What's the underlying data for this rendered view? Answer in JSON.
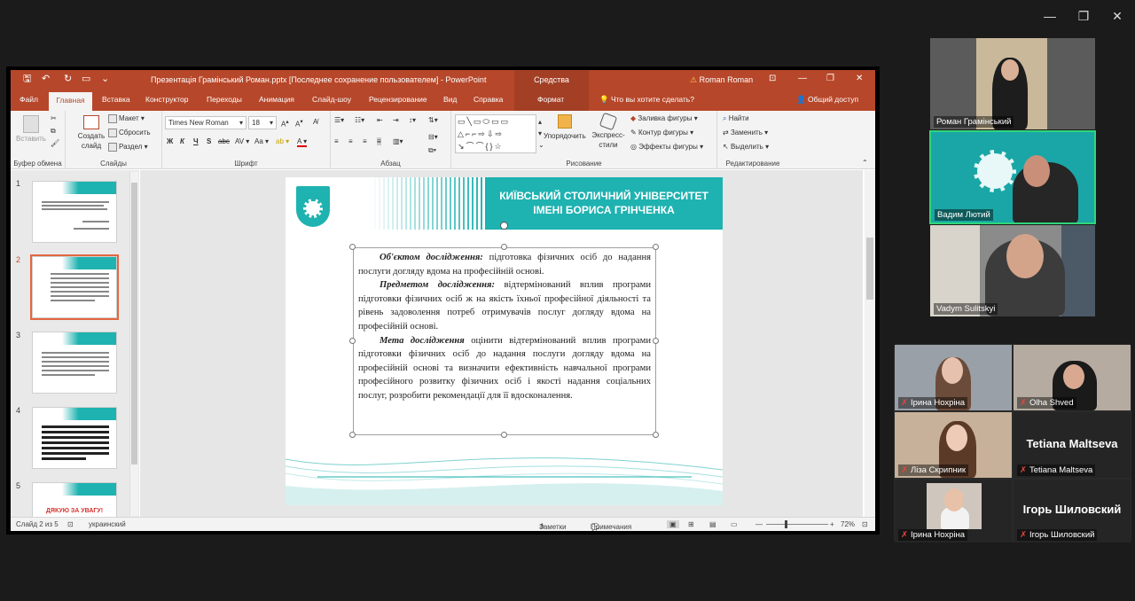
{
  "window_controls": {
    "minimize": "—",
    "maximize": "❐",
    "close": "✕"
  },
  "ppt": {
    "title": "Презентація Грамінський Роман.pptx [Последнее сохранение пользователем] - PowerPoint",
    "context_tab_title": "Средства рисования",
    "user": "Roman Roman",
    "tabs": [
      "Файл",
      "Главная",
      "Вставка",
      "Конструктор",
      "Переходы",
      "Анимация",
      "Слайд-шоу",
      "Рецензирование",
      "Вид",
      "Справка"
    ],
    "context_tab": "Формат",
    "tell_me": "Что вы хотите сделать?",
    "share": "Общий доступ",
    "ribbon": {
      "clipboard": {
        "paste": "Вставить",
        "label": "Буфер обмена"
      },
      "slides": {
        "new_slide": "Создать слайд",
        "layout": "Макет",
        "reset": "Сбросить",
        "section": "Раздел",
        "label": "Слайды"
      },
      "font": {
        "name": "Times New Roman",
        "size": "18",
        "label": "Шрифт"
      },
      "paragraph": {
        "label": "Абзац"
      },
      "drawing": {
        "arrange": "Упорядочить",
        "styles": "Экспресс-стили",
        "fill": "Заливка фигуры",
        "outline": "Контур фигуры",
        "effects": "Эффекты фигуры",
        "label": "Рисование"
      },
      "editing": {
        "find": "Найти",
        "replace": "Заменить",
        "select": "Выделить",
        "label": "Редактирование"
      }
    },
    "thumbnails": [
      {
        "number": "1"
      },
      {
        "number": "2"
      },
      {
        "number": "3"
      },
      {
        "number": "4"
      },
      {
        "number": "5",
        "text": "ДЯКУЮ ЗА УВАГУ!"
      }
    ],
    "slide": {
      "banner": "КИЇВСЬКИЙ СТОЛИЧНИЙ УНІВЕРСИТЕТ ІМЕНІ БОРИСА ГРІНЧЕНКА",
      "p1_title": "Об'єктом дослідження:",
      "p1_text": " підготовка фізичних осіб до надання послуги догляду вдома на професійній основі.",
      "p2_title": "Предметом дослідження:",
      "p2_text": " відтермінований вплив програми підготовки фізичних осіб ж на якість їхньої професійної діяльності та рівень задоволення потреб отримувачів послуг догляду вдома на професійній основі.",
      "p3_title": "Мета дослідження",
      "p3_text": " оцінити відтермінований вплив програми підготовки фізичних осіб до надання послуги догляду вдома на професійній основі та визначити ефективність навчальної програми професійного розвитку фізичних осіб і якості надання соціальних послуг, розробити рекомендації для її вдосконалення."
    },
    "status": {
      "slide": "Слайд 2 из 5",
      "language": "украинский",
      "notes": "Заметки",
      "comments": "Примечания",
      "zoom": "72%"
    }
  },
  "participants": [
    {
      "name": "Роман Грамінський"
    },
    {
      "name": "Вадим Лютий"
    },
    {
      "name": "Vadym Sulitskyi"
    },
    {
      "name": "Ірина Нохріна"
    },
    {
      "name": "Olha Shved"
    },
    {
      "name": "Ліза Скрипник"
    },
    {
      "name": "Tetiana Maltseva",
      "big": "Tetiana Maltseva"
    },
    {
      "name": "Ірина Нохріна"
    },
    {
      "name": "Ігорь Шиловский",
      "big": "Ігорь  Шиловский"
    }
  ],
  "colors": {
    "ppt_red": "#b7472a",
    "teal": "#1eb2b0",
    "active_speaker": "#2fd67b"
  }
}
